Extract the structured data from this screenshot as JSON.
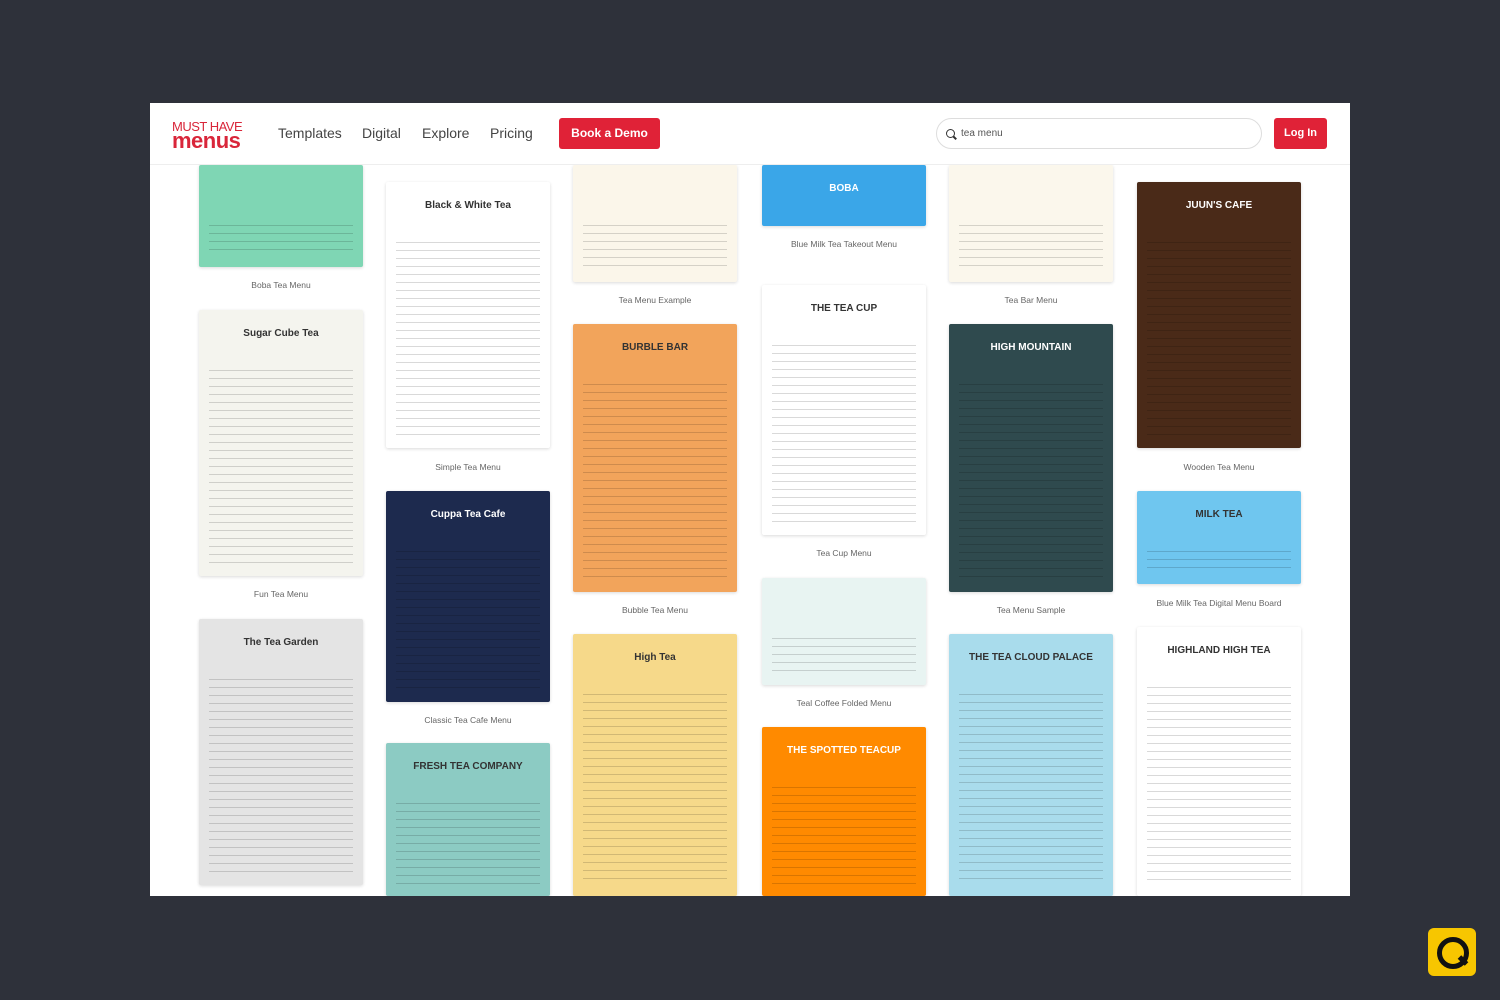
{
  "header": {
    "logo_top": "MUST HAVE",
    "logo_bottom": "menus",
    "nav": [
      "Templates",
      "Digital",
      "Explore",
      "Pricing"
    ],
    "demo_button": "Book a Demo",
    "search_value": "tea menu",
    "login_button": "Log In"
  },
  "colors": {
    "accent": "#e02237",
    "background": "#2e313a"
  },
  "templates": [
    {
      "caption": "Boba Tea Menu",
      "thumb": "",
      "color": "#7fd6b4"
    },
    {
      "caption": "Fun Tea Menu",
      "thumb": "Sugar Cube Tea",
      "color": "#f4f4ee"
    },
    {
      "caption": "",
      "thumb": "The Tea Garden",
      "color": "#e4e4e4"
    },
    {
      "caption": "Simple Tea Menu",
      "thumb": "Black & White Tea",
      "color": "#ffffff"
    },
    {
      "caption": "Classic Tea Cafe Menu",
      "thumb": "Cuppa Tea Cafe",
      "color": "#1d2a4e"
    },
    {
      "caption": "",
      "thumb": "FRESH TEA COMPANY",
      "color": "#8ccbc3"
    },
    {
      "caption": "Tea Menu Example",
      "thumb": "",
      "color": "#fbf6ea"
    },
    {
      "caption": "Bubble Tea Menu",
      "thumb": "BURBLE BAR",
      "color": "#f2a45b"
    },
    {
      "caption": "",
      "thumb": "High Tea",
      "color": "#f6d98a"
    },
    {
      "caption": "Blue Milk Tea Takeout Menu",
      "thumb": "BOBA",
      "color": "#3aa6e8"
    },
    {
      "caption": "Tea Cup Menu",
      "thumb": "THE TEA CUP",
      "color": "#ffffff"
    },
    {
      "caption": "Teal Coffee Folded Menu",
      "thumb": "",
      "color": "#e8f4f2"
    },
    {
      "caption": "",
      "thumb": "THE SPOTTED TEACUP",
      "color": "#ff8a00"
    },
    {
      "caption": "Tea Bar Menu",
      "thumb": "",
      "color": "#fbf7ec"
    },
    {
      "caption": "Tea Menu Sample",
      "thumb": "HIGH MOUNTAIN",
      "color": "#2f4a4e"
    },
    {
      "caption": "",
      "thumb": "THE TEA CLOUD PALACE",
      "color": "#a9dcec"
    },
    {
      "caption": "Wooden Tea Menu",
      "thumb": "JUUN'S CAFE",
      "color": "#4a2a18"
    },
    {
      "caption": "Blue Milk Tea Digital Menu Board",
      "thumb": "MILK TEA",
      "color": "#6fc6ef"
    },
    {
      "caption": "",
      "thumb": "HIGHLAND HIGH TEA",
      "color": "#ffffff"
    }
  ]
}
